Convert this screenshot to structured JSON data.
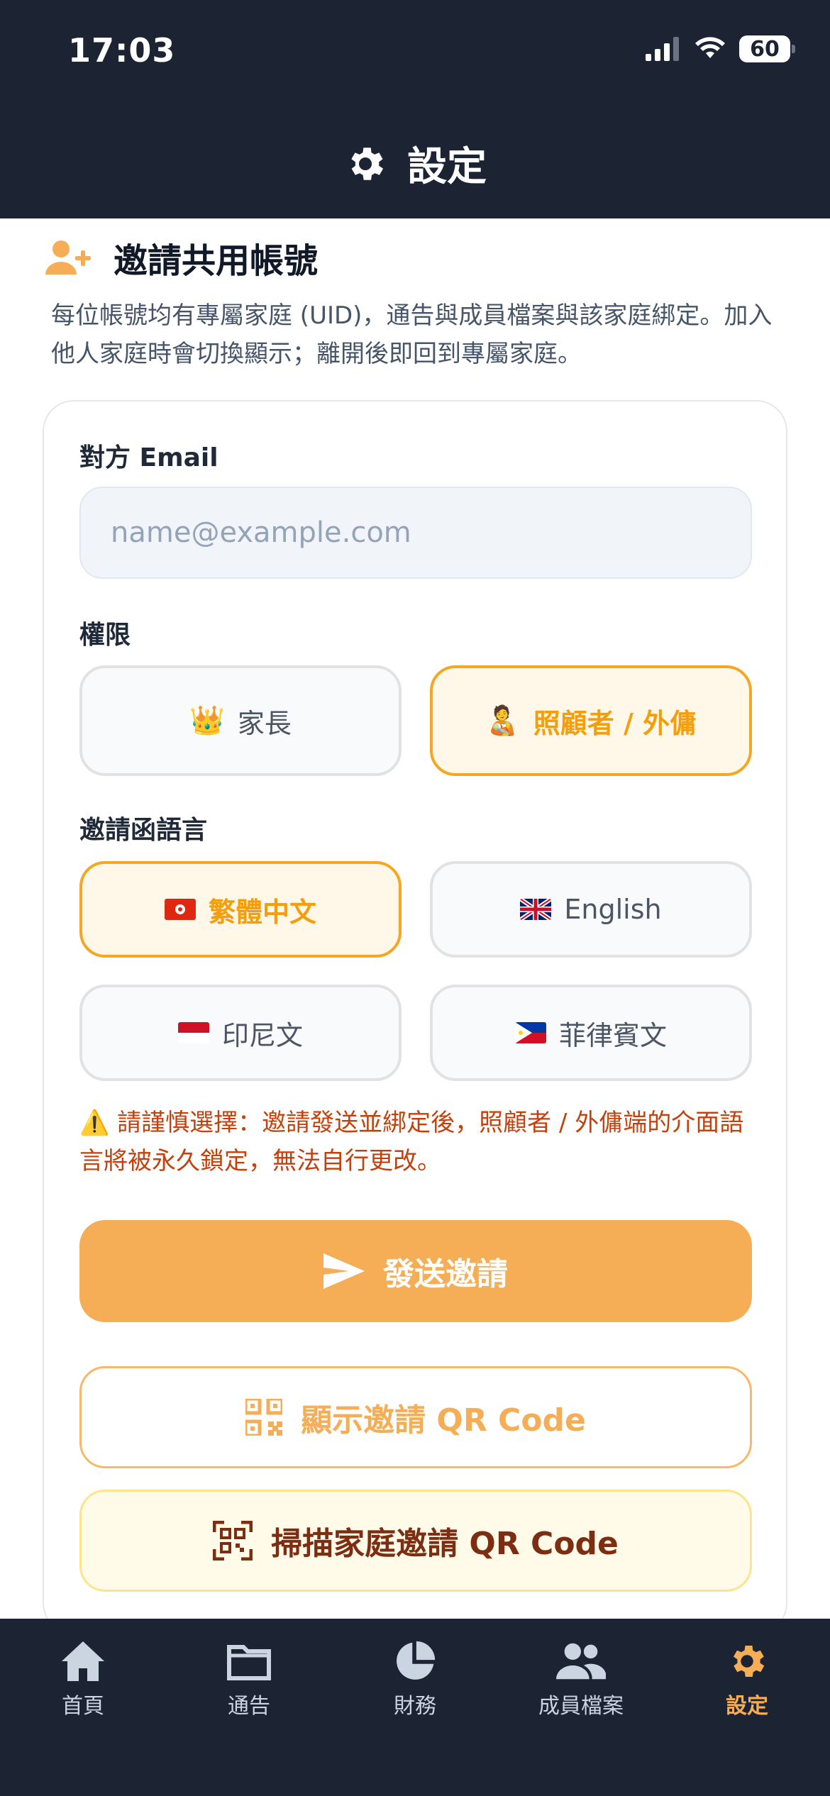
{
  "status_bar": {
    "time": "17:03",
    "battery": "60"
  },
  "header": {
    "title": "設定"
  },
  "section": {
    "title": "邀請共用帳號",
    "description": "每位帳號均有專屬家庭 (UID)，通告與成員檔案與該家庭綁定。加入他人家庭時會切換顯示；離開後即回到專屬家庭。"
  },
  "form": {
    "email_label": "對方 Email",
    "email_placeholder": "name@example.com",
    "email_value": "",
    "permission_label": "權限",
    "permissions": [
      {
        "label": "家長",
        "emoji": "👑",
        "selected": false
      },
      {
        "label": "照顧者 / 外傭",
        "emoji": "🧑‍🍼",
        "selected": true
      }
    ],
    "language_label": "邀請函語言",
    "languages": [
      {
        "label": "繁體中文",
        "flag": "hk-flag",
        "selected": true
      },
      {
        "label": "English",
        "flag": "uk-flag",
        "selected": false
      },
      {
        "label": "印尼文",
        "flag": "id-flag",
        "selected": false
      },
      {
        "label": "菲律賓文",
        "flag": "ph-flag",
        "selected": false
      }
    ],
    "warning_icon": "⚠️",
    "warning": "請謹慎選擇：邀請發送並綁定後，照顧者 / 外傭端的介面語言將被永久鎖定，無法自行更改。",
    "send_label": "發送邀請",
    "show_qr_label": "顯示邀請 QR Code",
    "scan_qr_label": "掃描家庭邀請 QR Code"
  },
  "tabs": [
    {
      "label": "首頁",
      "icon": "home-icon",
      "active": false
    },
    {
      "label": "通告",
      "icon": "folder-icon",
      "active": false
    },
    {
      "label": "財務",
      "icon": "pie-chart-icon",
      "active": false
    },
    {
      "label": "成員檔案",
      "icon": "people-icon",
      "active": false
    },
    {
      "label": "設定",
      "icon": "gear-icon",
      "active": true
    }
  ],
  "colors": {
    "accent": "#f6ae56",
    "dark": "#1c2333",
    "warning": "#c2410c"
  }
}
